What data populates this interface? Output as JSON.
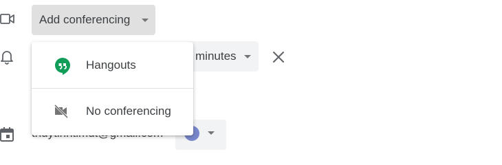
{
  "conferencing": {
    "select_label": "Add conferencing",
    "icon": "video-camera-icon",
    "options": [
      {
        "label": "Hangouts",
        "icon": "hangouts-icon",
        "color": "#0f9d58"
      },
      {
        "label": "No conferencing",
        "icon": "video-off-icon"
      }
    ]
  },
  "notification": {
    "icon": "bell-icon",
    "unit_label": "minutes"
  },
  "calendar": {
    "icon": "calendar-icon",
    "owner_email": "thuytinhtimdt@gmail.com",
    "event_color": "#7986cb"
  },
  "colors": {
    "select_bg": "#e0e0e0",
    "field_bg": "#f1f3f4",
    "text": "#3c4043",
    "icon": "#5f6368"
  }
}
